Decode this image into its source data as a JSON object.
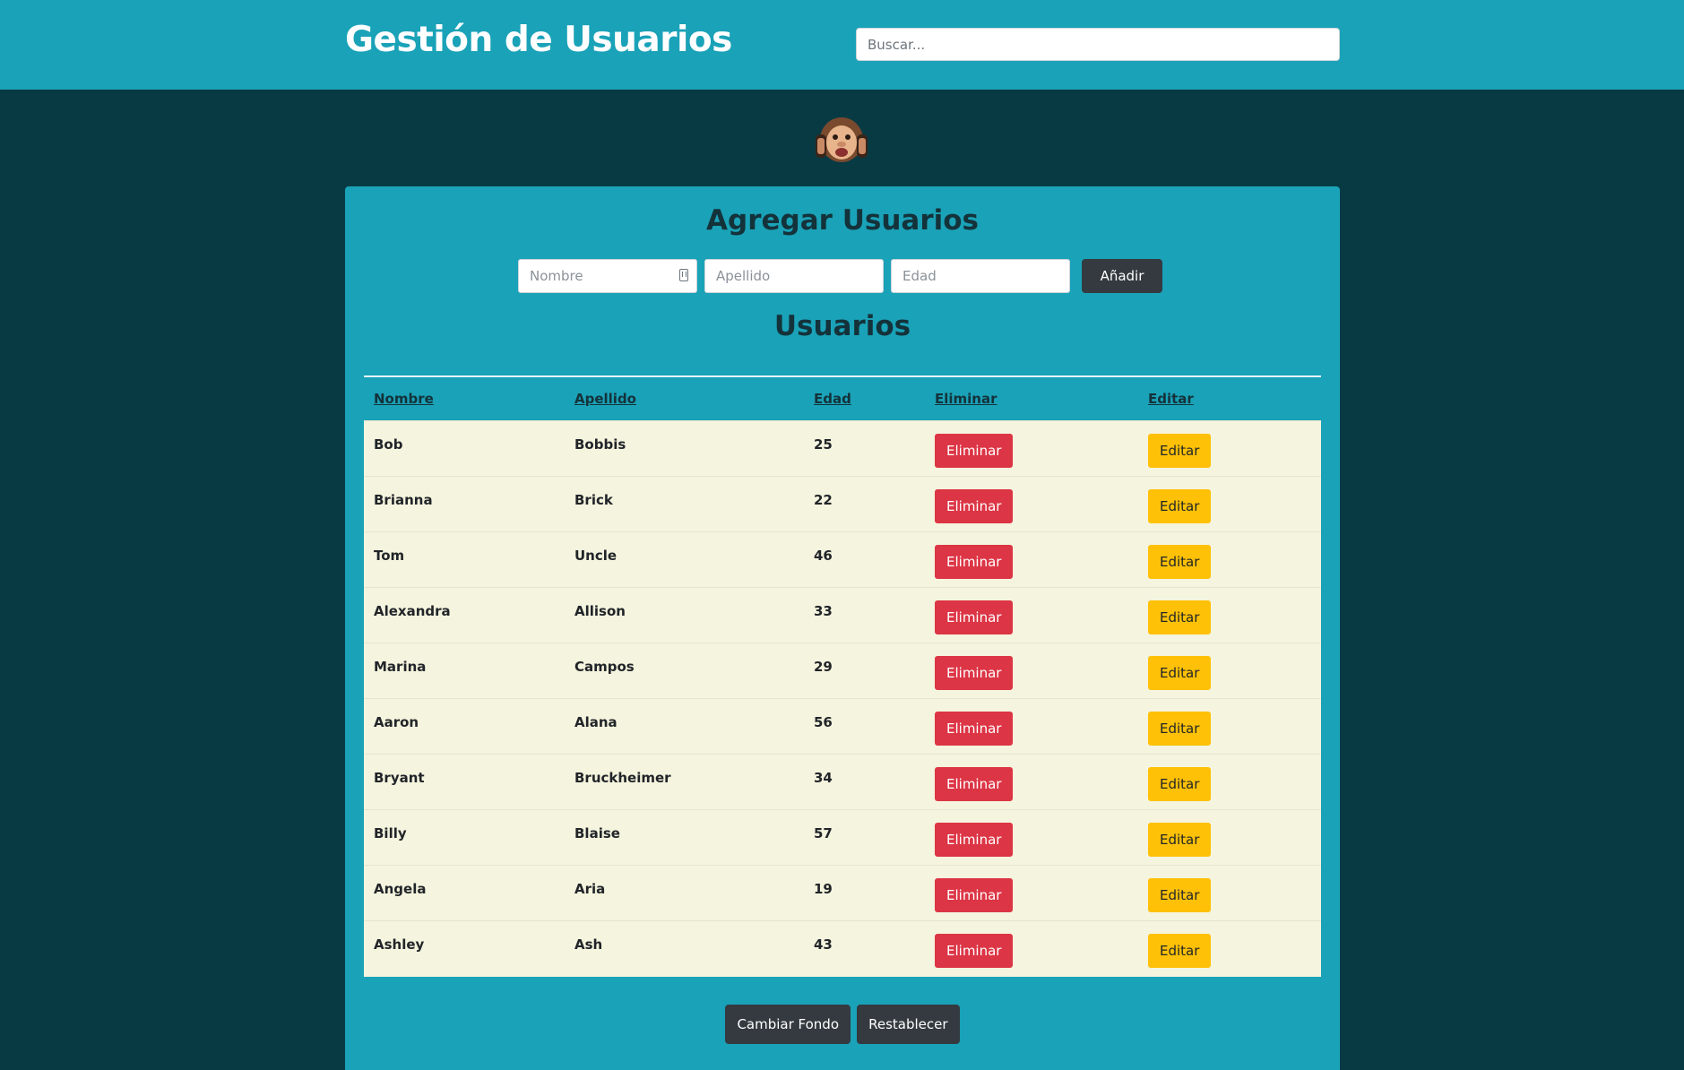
{
  "header": {
    "title": "Gestión de Usuarios",
    "search_placeholder": "Buscar..."
  },
  "hero": {
    "icon": "hear-no-evil-monkey-icon"
  },
  "add_form": {
    "heading": "Agregar Usuarios",
    "nombre_placeholder": "Nombre",
    "apellido_placeholder": "Apellido",
    "edad_placeholder": "Edad",
    "submit_label": "Añadir"
  },
  "users": {
    "heading": "Usuarios",
    "columns": [
      "Nombre",
      "Apellido",
      "Edad",
      "Eliminar",
      "Editar"
    ],
    "rows": [
      {
        "nombre": "Bob",
        "apellido": "Bobbis",
        "edad": "25"
      },
      {
        "nombre": "Brianna",
        "apellido": "Brick",
        "edad": "22"
      },
      {
        "nombre": "Tom",
        "apellido": "Uncle",
        "edad": "46"
      },
      {
        "nombre": "Alexandra",
        "apellido": "Allison",
        "edad": "33"
      },
      {
        "nombre": "Marina",
        "apellido": "Campos",
        "edad": "29"
      },
      {
        "nombre": "Aaron",
        "apellido": "Alana",
        "edad": "56"
      },
      {
        "nombre": "Bryant",
        "apellido": "Bruckheimer",
        "edad": "34"
      },
      {
        "nombre": "Billy",
        "apellido": "Blaise",
        "edad": "57"
      },
      {
        "nombre": "Angela",
        "apellido": "Aria",
        "edad": "19"
      },
      {
        "nombre": "Ashley",
        "apellido": "Ash",
        "edad": "43"
      }
    ],
    "delete_label": "Eliminar",
    "edit_label": "Editar"
  },
  "footer_actions": {
    "change_bg_label": "Cambiar Fondo",
    "reset_label": "Restablecer"
  },
  "colors": {
    "header_bg": "#1aa2b8",
    "page_bg": "#083a44",
    "row_bg": "#f5f4de",
    "danger": "#dc3545",
    "warning": "#ffc107",
    "dark": "#343a40"
  }
}
